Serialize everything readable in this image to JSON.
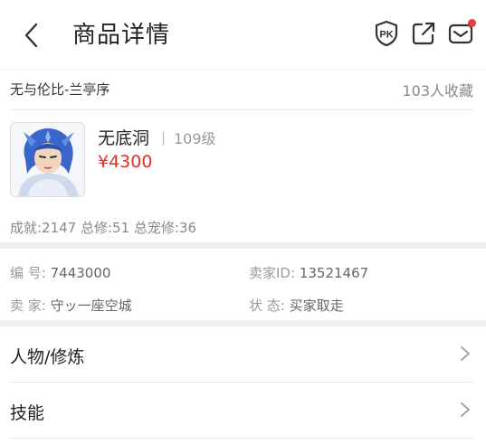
{
  "header": {
    "title": "商品详情",
    "icons": [
      "back-chevron-icon",
      "pk-shield-icon",
      "share-external-icon",
      "mail-icon"
    ],
    "notification_dot_color": "#e83b3b"
  },
  "listing": {
    "name": "无与伦比-兰亭序",
    "favorites": "103人收藏"
  },
  "item": {
    "name": "无底洞",
    "separator": "|",
    "level": "109级",
    "price": "¥4300",
    "price_color": "#e0302a",
    "stats": "成就:2147 总修:51 总宠修:36"
  },
  "details": {
    "serial_label": "编  号:",
    "serial_value": "7443000",
    "seller_id_label": "卖家ID:",
    "seller_id_value": "13521467",
    "seller_label": "卖  家:",
    "seller_value": "守ッ一座空城",
    "status_label": "状  态:",
    "status_value": "买家取走"
  },
  "sections": [
    {
      "label": "人物/修炼"
    },
    {
      "label": "技能"
    }
  ]
}
